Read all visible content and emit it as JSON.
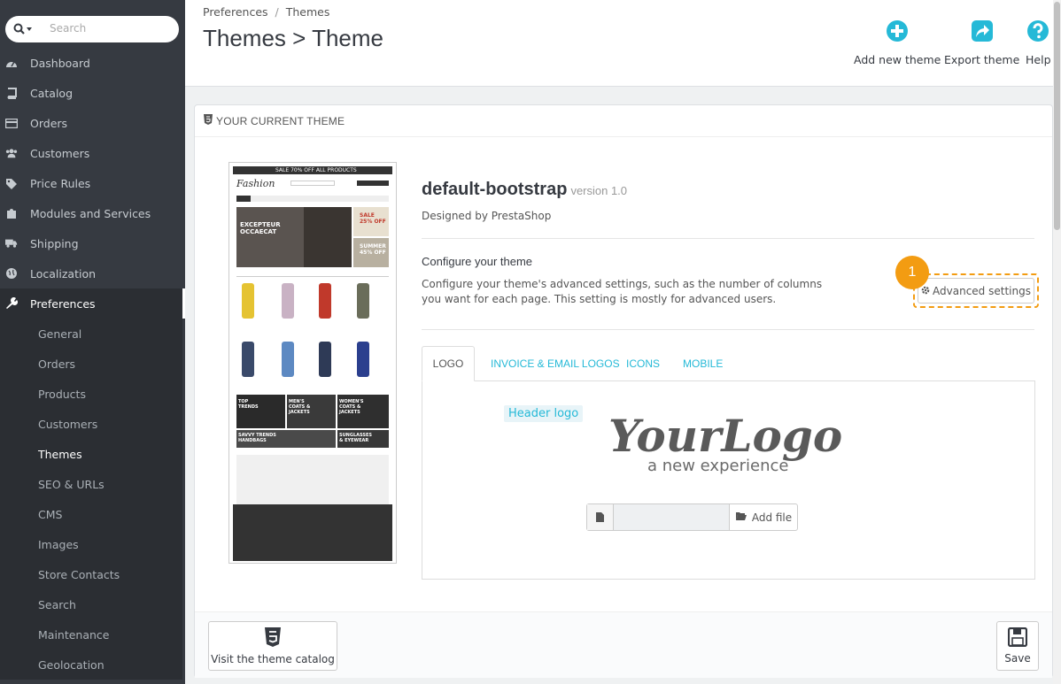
{
  "search": {
    "placeholder": "Search"
  },
  "sidebar": {
    "items": [
      {
        "label": "Dashboard",
        "icon": "dashboard-icon"
      },
      {
        "label": "Catalog",
        "icon": "book-icon"
      },
      {
        "label": "Orders",
        "icon": "credit-card-icon"
      },
      {
        "label": "Customers",
        "icon": "users-icon"
      },
      {
        "label": "Price Rules",
        "icon": "tags-icon"
      },
      {
        "label": "Modules and Services",
        "icon": "puzzle-icon"
      },
      {
        "label": "Shipping",
        "icon": "truck-icon"
      },
      {
        "label": "Localization",
        "icon": "globe-icon"
      },
      {
        "label": "Preferences",
        "icon": "wrench-icon"
      }
    ],
    "sub_items": [
      "General",
      "Orders",
      "Products",
      "Customers",
      "Themes",
      "SEO & URLs",
      "CMS",
      "Images",
      "Store Contacts",
      "Search",
      "Maintenance",
      "Geolocation"
    ]
  },
  "header": {
    "breadcrumb": [
      "Preferences",
      "Themes"
    ],
    "breadcrumb_separator": "/",
    "title": "Themes > Theme",
    "actions": {
      "add_new_theme": "Add new theme",
      "export_theme": "Export theme",
      "help": "Help"
    }
  },
  "panel": {
    "heading": "YOUR CURRENT THEME",
    "theme_name": "default-bootstrap",
    "theme_version": "version 1.0",
    "designed_by": "Designed by PrestaShop",
    "configure_title": "Configure your theme",
    "configure_desc": "Configure your theme's advanced settings, such as the number of columns you want for each page. This setting is mostly for advanced users.",
    "advanced_settings": "Advanced settings",
    "step_badge": "1",
    "tabs": [
      "LOGO",
      "INVOICE & EMAIL LOGOS",
      "ICONS",
      "MOBILE"
    ],
    "header_logo_label": "Header logo",
    "logo_main": "YourLogo",
    "logo_sub": "a new experience",
    "add_file": "Add file",
    "visit_catalog": "Visit the theme catalog",
    "save": "Save"
  },
  "preview": {
    "sale_banner": "SALE 70% OFF ALL PRODUCTS",
    "shop_name": "Fashion",
    "hero_title": "EXCEPTEUR OCCAECAT",
    "promo1": "SALE 25% OFF",
    "promo2": "SUMMER 45% OFF",
    "tiles": [
      "TOP TRENDS",
      "MEN'S COATS & JACKETS",
      "WOMEN'S COATS & JACKETS",
      "SAVVY TRENDS HANDBAGS",
      "SUNGLASSES & EYEWEAR"
    ]
  },
  "colors": {
    "sidebar_bg": "#363a41",
    "accent": "#25b9d7",
    "highlight": "#f39c12"
  }
}
